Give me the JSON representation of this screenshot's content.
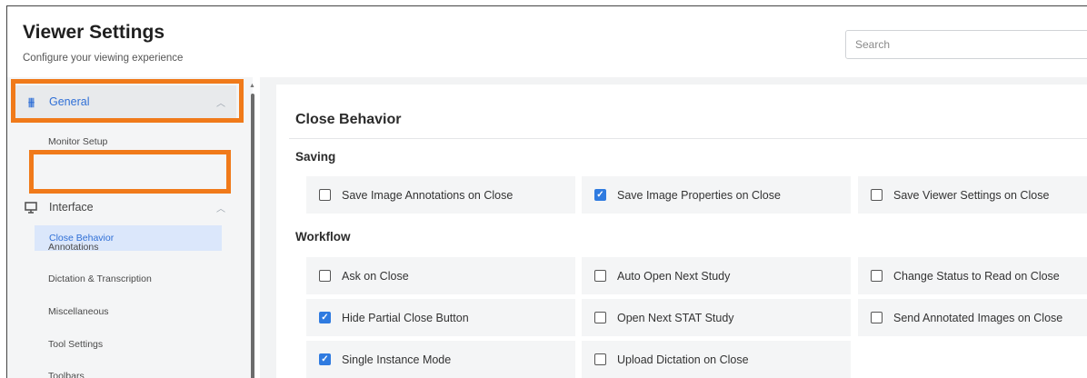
{
  "header": {
    "title": "Viewer Settings",
    "subtitle": "Configure your viewing experience",
    "search_placeholder": "Search"
  },
  "sidebar": {
    "general": {
      "label": "General",
      "icon": "sliders-icon"
    },
    "general_items": [
      "Monitor Setup",
      "Close Behavior"
    ],
    "interface": {
      "label": "Interface",
      "icon": "monitor-icon"
    },
    "interface_items": [
      "Annotations",
      "Dictation & Transcription",
      "Miscellaneous",
      "Tool Settings",
      "Toolbars"
    ],
    "active_item": "Close Behavior",
    "highlight_color": "#f07a1a"
  },
  "main": {
    "section_title": "Close Behavior",
    "saving": {
      "label": "Saving",
      "options": [
        {
          "label": "Save Image Annotations on Close",
          "checked": false
        },
        {
          "label": "Save Image Properties on Close",
          "checked": true
        },
        {
          "label": "Save Viewer Settings on Close",
          "checked": false
        }
      ]
    },
    "workflow": {
      "label": "Workflow",
      "options": [
        {
          "label": "Ask on Close",
          "checked": false
        },
        {
          "label": "Auto Open Next Study",
          "checked": false
        },
        {
          "label": "Change Status to Read on Close",
          "checked": false
        },
        {
          "label": "Hide Partial Close Button",
          "checked": true
        },
        {
          "label": "Open Next STAT Study",
          "checked": false
        },
        {
          "label": "Send Annotated Images on Close",
          "checked": false
        },
        {
          "label": "Single Instance Mode",
          "checked": true
        },
        {
          "label": "Upload Dictation on Close",
          "checked": false
        }
      ]
    }
  },
  "colors": {
    "accent": "#2f6fd6",
    "checkbox_checked": "#2f7be0"
  }
}
